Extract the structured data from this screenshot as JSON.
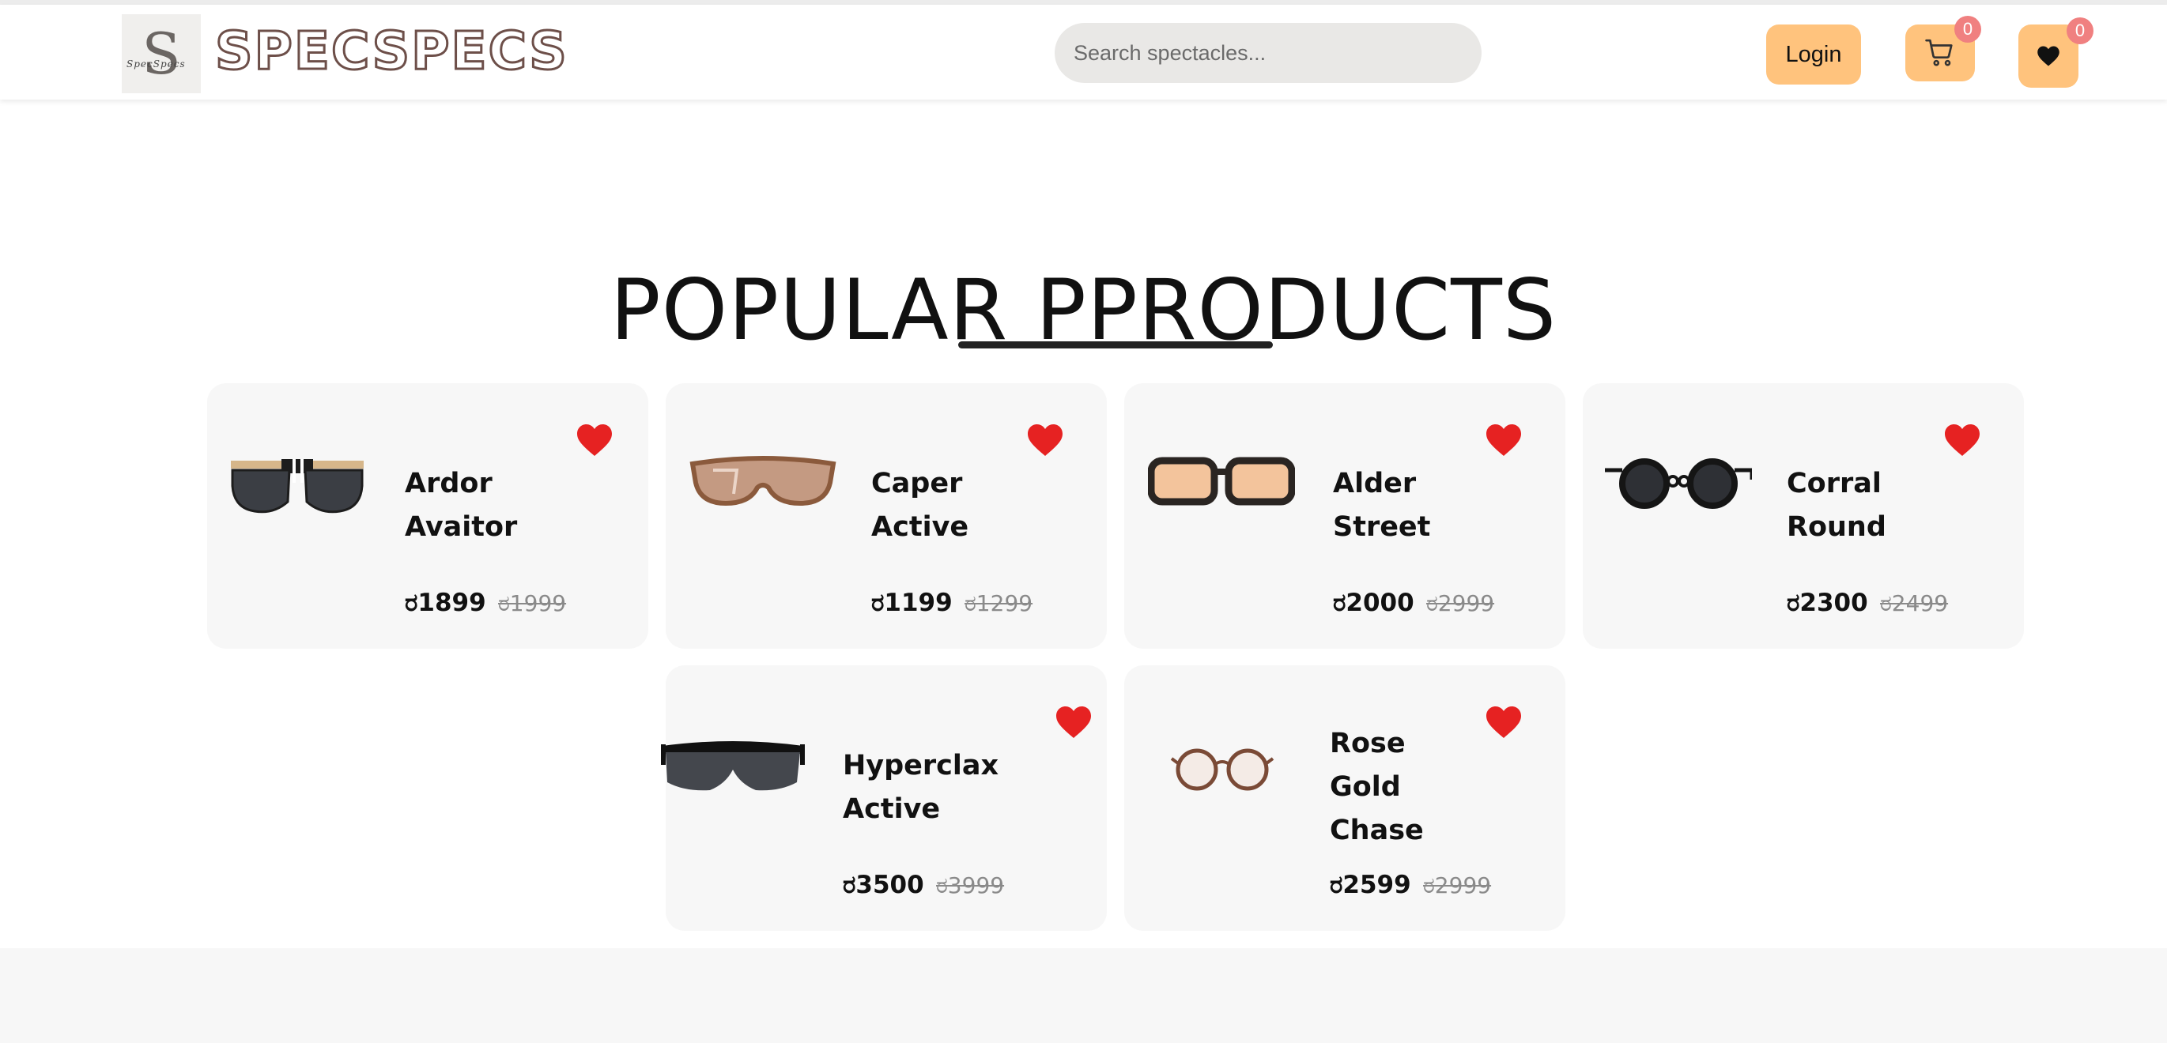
{
  "header": {
    "logo_letter": "S",
    "logo_script": "SpecSpecs",
    "brand": "SPECSPECS",
    "search_placeholder": "Search spectacles...",
    "login_label": "Login",
    "cart_count": "0",
    "wishlist_count": "0"
  },
  "section": {
    "title": "POPULAR PPRODUCTS"
  },
  "products": [
    {
      "name": "Ardor\nAvaitor",
      "price": "ರ1899",
      "old_price": "ರ1999",
      "frame_color": "#1d1d1d",
      "lens_color": "#3b3e44"
    },
    {
      "name": "Caper\nActive",
      "price": "ರ1199",
      "old_price": "ರ1299",
      "frame_color": "#8b5a3c",
      "lens_color": "#c49a82"
    },
    {
      "name": "Alder\nStreet",
      "price": "ರ2000",
      "old_price": "ರ2999",
      "frame_color": "#2a2522",
      "lens_color": "#f3c49c"
    },
    {
      "name": "Corral\nRound",
      "price": "ರ2300",
      "old_price": "ರ2499",
      "frame_color": "#151515",
      "lens_color": "#2e3035"
    },
    {
      "name": "Hyperclax\nActive",
      "price": "ರ3500",
      "old_price": "ರ3999",
      "frame_color": "#111111",
      "lens_color": "#44474d"
    },
    {
      "name": "Rose\nGold\nChase",
      "price": "ರ2599",
      "old_price": "ರ2999",
      "frame_color": "#7a4a36",
      "lens_color": "#f4ebe6"
    }
  ],
  "colors": {
    "accent": "#ffc37d",
    "heart": "#e62222",
    "badge": "#f08080"
  }
}
